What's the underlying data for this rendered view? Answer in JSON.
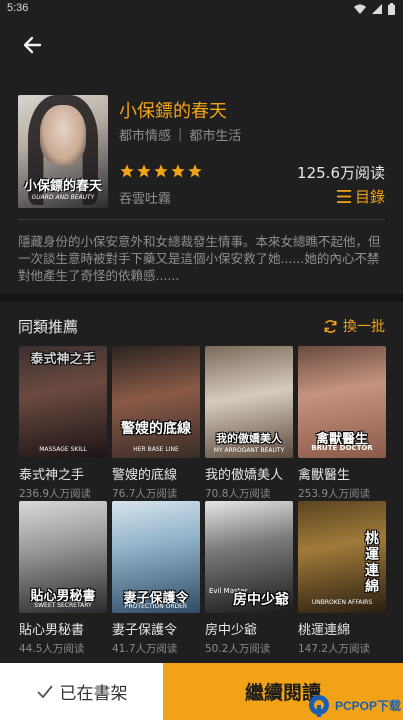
{
  "status_bar": {
    "time": "5:36"
  },
  "book": {
    "title": "小保鏢的春天",
    "tags": [
      "都市情感",
      "都市生活"
    ],
    "rating_stars": 5,
    "reads": "125.6万阅读",
    "author": "吞雲吐霧",
    "toc_label": "目錄",
    "cover_title": "小保鏢的春天",
    "cover_subtitle": "GUARD AND BEAUTY",
    "synopsis": "隱藏身份的小保安意外和女總裁發生情事。本來女總瞧不起他，但一次談生意時被對手下藥又是這個小保安救了她......她的內心不禁對他產生了奇怪的依賴感......"
  },
  "recommend": {
    "title": "同類推薦",
    "refresh_label": "換一批",
    "items": [
      {
        "name": "泰式神之手",
        "reads": "236.9人万阅读",
        "cover_text": "泰式神之手",
        "cover_sub": "MASSAGE SKILL"
      },
      {
        "name": "警嫂的底線",
        "reads": "76.7人万阅读",
        "cover_text": "警嫂的底線",
        "cover_sub": "HER BASE LINE"
      },
      {
        "name": "我的傲嬌美人",
        "reads": "70.8人万阅读",
        "cover_text": "我的傲嬌美人",
        "cover_sub": "MY ARROGANT BEAUTY"
      },
      {
        "name": "禽獸醫生",
        "reads": "253.9人万阅读",
        "cover_text": "禽獸醫生",
        "cover_sub": "BRUTE DOCTOR"
      },
      {
        "name": "貼心男秘書",
        "reads": "44.5人万阅读",
        "cover_text": "貼心男秘書",
        "cover_sub": "SWEET SECRETARY"
      },
      {
        "name": "妻子保護令",
        "reads": "41.7人万阅读",
        "cover_text": "妻子保護令",
        "cover_sub": "PROTECTION ORDER"
      },
      {
        "name": "房中少爺",
        "reads": "50.2人万阅读",
        "cover_text": "房中少爺",
        "cover_sub": "Evil Master"
      },
      {
        "name": "桃運連綿",
        "reads": "147.2人万阅读",
        "cover_text": "桃運連綿",
        "cover_sub": "UNBROKEN AFFAIRS"
      }
    ]
  },
  "bottom_bar": {
    "shelf_label": "已在書架",
    "read_label": "繼續閱讀"
  },
  "watermark": {
    "text": "PCPOP下载"
  },
  "colors": {
    "accent": "#f2a216",
    "background": "#1f1f1f"
  }
}
